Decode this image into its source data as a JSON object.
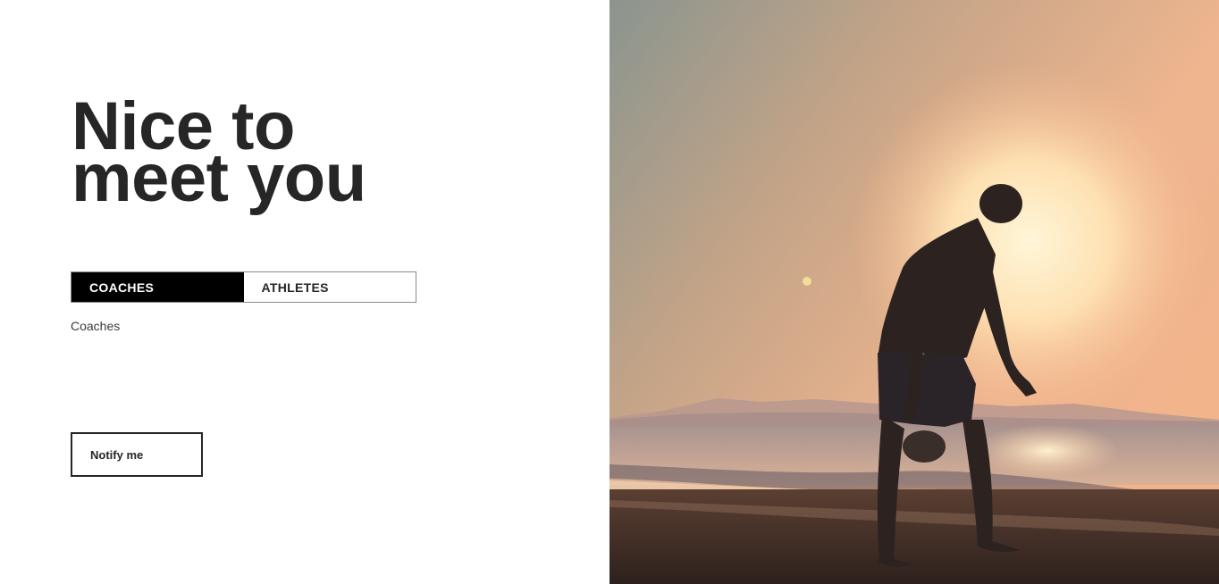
{
  "hero": {
    "headline_line1": "Nice to",
    "headline_line2": "meet you"
  },
  "audience_toggle": {
    "options": [
      {
        "label": "COACHES",
        "selected": true
      },
      {
        "label": "ATHLETES",
        "selected": false
      }
    ],
    "selected_text": "Coaches"
  },
  "cta": {
    "notify_label": "Notify me"
  },
  "photo": {
    "subject": "man silhouetted on beach at sunset holding a kettlebell"
  },
  "colors": {
    "text": "#262626",
    "active_tab_bg": "#000000",
    "active_tab_text": "#ffffff",
    "sky_top": "#8f9990",
    "sun": "#fff2c8",
    "sea": "#9f8a86",
    "sand": "#3a2a22"
  }
}
